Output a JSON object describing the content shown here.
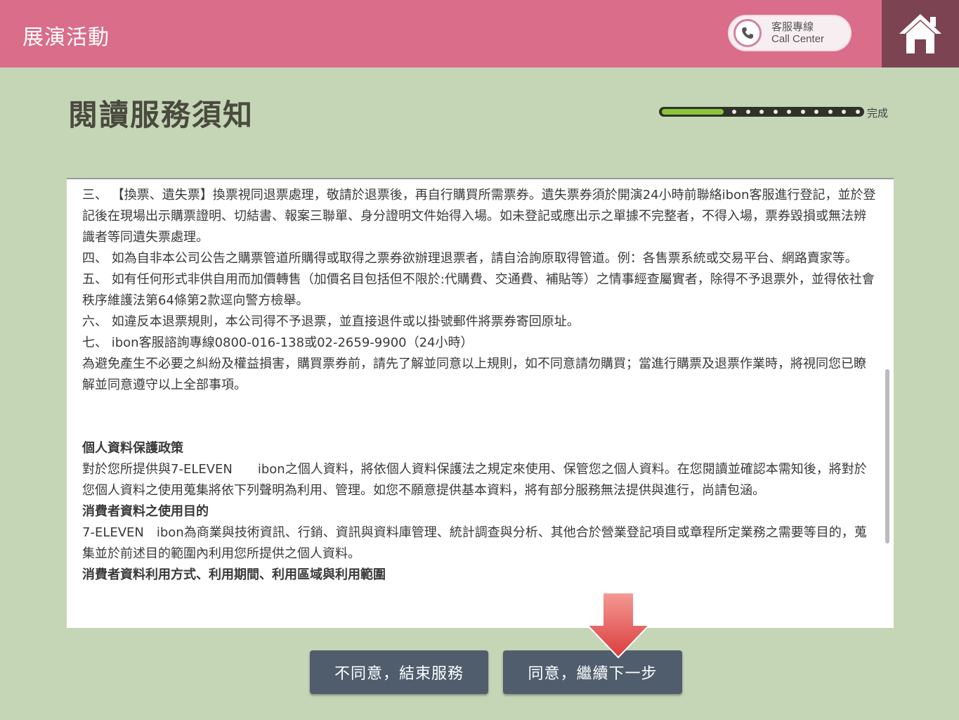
{
  "header": {
    "app_title": "展演活動",
    "call_center": {
      "label_zh": "客服專線",
      "label_en": "Call Center",
      "icon": "phone-icon"
    },
    "home_icon": "home-icon"
  },
  "page": {
    "title": "閱讀服務須知"
  },
  "progress": {
    "label": "完成",
    "value": 0.31
  },
  "notice": {
    "paragraphs": [
      "三、 【換票、遺失票】換票視同退票處理，敬請於退票後，再自行購買所需票券。遺失票券須於開演24小時前聯絡ibon客服進行登記，並於登記後在現場出示購票證明、切結書、報案三聯單、身分證明文件始得入場。如未登記或應出示之單據不完整者，不得入場，票券毀損或無法辨識者等同遺失票處理。",
      "四、 如為自非本公司公告之購票管道所購得或取得之票券欲辦理退票者，請自洽詢原取得管道。例：各售票系統或交易平台、網路賣家等。",
      "五、 如有任何形式非供自用而加價轉售（加價名目包括但不限於:代購費、交通費、補貼等）之情事經查屬實者，除得不予退票外，並得依社會秩序維護法第64條第2款逕向警方檢舉。",
      "六、 如違反本退票規則，本公司得不予退票，並直接退件或以掛號郵件將票券寄回原址。",
      "七、 ibon客服諮詢專線0800-016-138或02-2659-9900（24小時）",
      "為避免產生不必要之糾紛及權益損害，購買票券前，請先了解並同意以上規則，如不同意請勿購買；當進行購票及退票作業時，將視同您已瞭解並同意遵守以上全部事項。"
    ],
    "privacy_heading": "個人資料保護政策",
    "privacy_text": "對於您所提供與7-ELEVEN　　ibon之個人資料，將依個人資料保護法之規定來使用、保管您之個人資料。在您閱讀並確認本需知後，將對於您個人資料之使用蒐集將依下列聲明為利用、管理。如您不願意提供基本資料，將有部分服務無法提供與進行，尚請包涵。",
    "purpose_heading": "消費者資料之使用目的",
    "purpose_text": "7-ELEVEN　ibon為商業與技術資訊、行銷、資訊與資料庫管理、統計調查與分析、其他合於營業登記項目或章程所定業務之需要等目的，蒐集並於前述目的範圍內利用您所提供之個人資料。",
    "usage_heading": "消費者資料利用方式、利用期間、利用區域與利用範圍"
  },
  "buttons": {
    "disagree_label": "不同意，結束服務",
    "agree_label": "同意，繼續下一步"
  },
  "colors": {
    "header_bg": "#d96d8a",
    "home_bg": "#7c4452",
    "page_bg": "#c5d6b7",
    "button_bg": "#4f5d6d",
    "progress_fill": "#8cc43d",
    "arrow": "#e8504f"
  }
}
